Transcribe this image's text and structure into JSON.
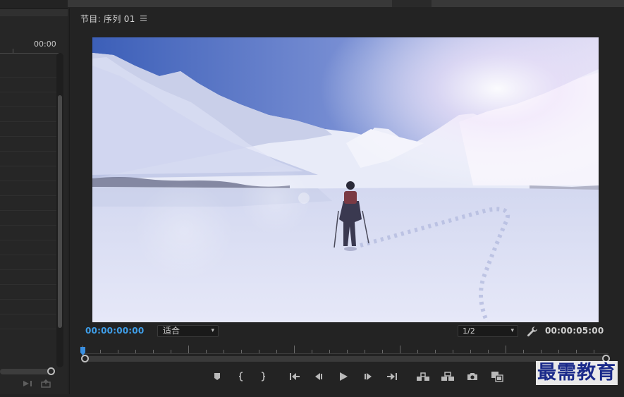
{
  "left_panel": {
    "timecode": "00:00",
    "icons": [
      "insert-clip-icon",
      "export-frame-icon"
    ]
  },
  "program_monitor": {
    "tab_title": "节目: 序列 01",
    "menu_icon": "hamburger-menu-icon",
    "current_timecode": "00:00:00:00",
    "fit_select": {
      "value": "适合"
    },
    "resolution_select": {
      "value": "1/2"
    },
    "duration_timecode": "00:00:05:00",
    "settings_icon": "wrench-icon",
    "playhead_position": 0.0,
    "video_scene": "snowy mountain valley with a hiker walking through snow, sun flare top-right",
    "transport_controls": [
      {
        "name": "add-marker-button",
        "icon": "marker-icon"
      },
      {
        "name": "mark-in-button",
        "icon": "mark-in-icon"
      },
      {
        "name": "mark-out-button",
        "icon": "mark-out-icon"
      },
      {
        "name": "go-to-in-button",
        "icon": "go-to-in-icon"
      },
      {
        "name": "step-back-button",
        "icon": "step-back-icon"
      },
      {
        "name": "play-button",
        "icon": "play-icon"
      },
      {
        "name": "step-forward-button",
        "icon": "step-forward-icon"
      },
      {
        "name": "go-to-out-button",
        "icon": "go-to-out-icon"
      },
      {
        "name": "lift-button",
        "icon": "lift-icon"
      },
      {
        "name": "extract-button",
        "icon": "extract-icon"
      },
      {
        "name": "export-frame-button",
        "icon": "camera-icon"
      },
      {
        "name": "compare-view-button",
        "icon": "compare-icon"
      }
    ]
  },
  "watermark": {
    "text": "最需教育"
  },
  "colors": {
    "accent_timecode": "#3f9ee8",
    "panel_background": "#232323",
    "watermark_text": "#1a2a8a"
  }
}
